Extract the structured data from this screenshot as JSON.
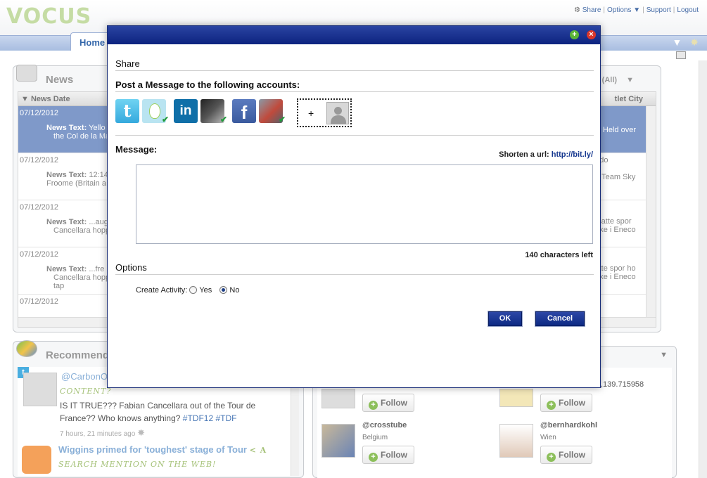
{
  "app": {
    "logo": "VOCUS",
    "top_links": {
      "share": "Share",
      "options": "Options ▼",
      "support": "Support",
      "logout": "Logout"
    },
    "home_tab": "Home"
  },
  "news": {
    "title": "News",
    "filter_label": "hes: (All)",
    "col_date": "▼ News Date",
    "col_outlet": "tlet City",
    "rows": [
      {
        "date": "07/12/2012",
        "label": "News Text:",
        "text1": "Yello",
        "text2": "the Col de la Ma",
        "right1": "ay. Held over",
        "right2": ""
      },
      {
        "date": "07/12/2012",
        "label": "News Text:",
        "text1": "12:14",
        "text2": "Froome (Britain a",
        "right1": "ando",
        "right2": "n / Team Sky"
      },
      {
        "date": "07/12/2012",
        "label": "News Text:",
        "text1": "...aug",
        "text2": "Cancellara hopp",
        "right1": "n satte spor",
        "right2": "oake i Eneco"
      },
      {
        "date": "07/12/2012",
        "label": "News Text:",
        "text1": "...fre",
        "text2": "Cancellara hopp",
        "right1": "satte spor ho",
        "right2": "oake i Eneco"
      }
    ],
    "last_date": "07/12/2012",
    "row4_extra": "tap"
  },
  "recommend": {
    "title": "Recommenda",
    "handle": "@CarbonO",
    "hand_label": "CONTENT?",
    "tweet_text": "IS IT TRUE??? Fabian Cancellara out of the Tour de France?? Who knows anything?",
    "hashtag1": "#TDF12",
    "hashtag2": "#TDF",
    "time": "7 hours, 21 minutes ago",
    "rss_title": "Wiggins primed for 'toughest' stage of Tour",
    "rss_suffix": "< A",
    "rss_label": "SEARCH MENTION ON THE WEB!"
  },
  "follow": {
    "coords_fragment": ",139.715958",
    "button_label": "Follow",
    "users": [
      {
        "handle": "@crosstube",
        "location": "Belgium"
      },
      {
        "handle": "@bernhardkohl",
        "location": "Wien"
      }
    ]
  },
  "modal": {
    "title_share": "Share",
    "post_heading": "Post a Message to the following accounts:",
    "accounts": [
      {
        "network": "twitter",
        "icon": "twitter-icon"
      },
      {
        "network": "linkedin",
        "icon": "linkedin-icon"
      },
      {
        "network": "facebook",
        "icon": "facebook-icon"
      }
    ],
    "add_account_plus": "+",
    "message_label": "Message:",
    "shorten_label": "Shorten a url:",
    "shorten_link": "http://bit.ly/",
    "message_value": "",
    "chars_left": "140 characters left",
    "options_label": "Options",
    "create_activity_label": "Create Activity:",
    "yes_label": "Yes",
    "no_label": "No",
    "selected": "No",
    "ok_label": "OK",
    "cancel_label": "Cancel"
  },
  "colors": {
    "modal_titlebar": "#0d237f",
    "button_blue": "#0d2a84",
    "selected_row": "#7f99c9",
    "logo_green": "#c5dca4"
  }
}
